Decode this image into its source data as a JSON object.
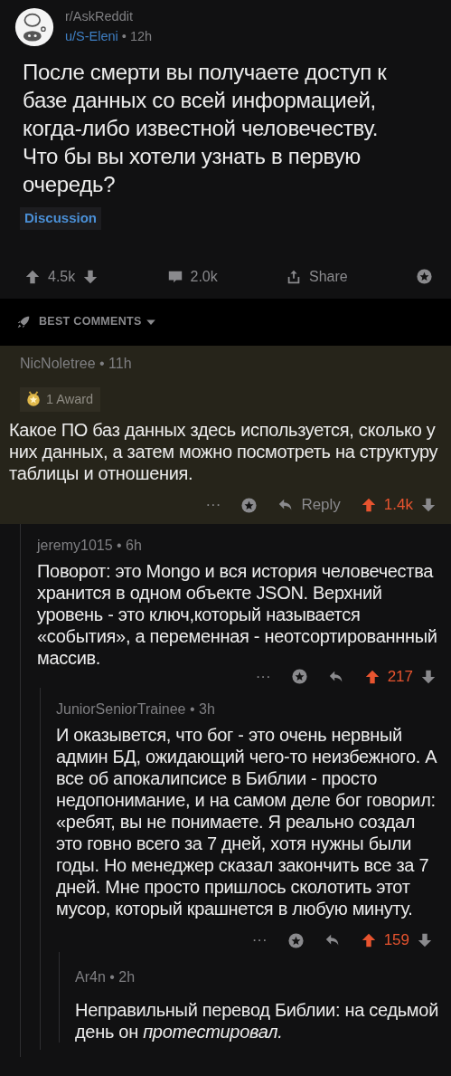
{
  "post": {
    "subreddit": "r/AskReddit",
    "author": "u/S-Eleni",
    "meta": "• 12h",
    "title": "После смерти вы получаете доступ к базе данных со всей информацией, когда-либо известной человечеству. Что бы вы хотели узнать в первую очередь?",
    "flair": "Discussion",
    "score": "4.5k",
    "upvoted": false,
    "comments": "2.0k",
    "share": "Share"
  },
  "sort": {
    "label": "BEST COMMENTS"
  },
  "comments": [
    {
      "meta": "NicNoletree • 11h",
      "highlighted": true,
      "award": "1 Award",
      "body": "Какое ПО баз данных здесь используется, сколько у них данных, а затем можно посмотреть на структуру таблицы и отношения.",
      "more": "···",
      "reply": "Reply",
      "score": "1.4k",
      "upvoted": true,
      "children": [
        {
          "meta": "jeremy1015 • 6h",
          "highlighted": false,
          "body": "Поворот: это Mongo и вся история человечества хранится в одном объекте JSON. Верхний уровень - это ключ,который называется «события», а переменная - неотсортированнный массив.",
          "more": "···",
          "score": "217",
          "upvoted": true,
          "children": [
            {
              "meta": "JuniorSeniorTrainee • 3h",
              "highlighted": false,
              "body": "И оказывется, что бог - это очень нервный админ БД, ожидающий чего-то неизбежного. А все об апокалипсисе в Библии - просто недопонимание, и на самом деле бог говорил: «ребят, вы не понимаете. Я реально создал это говно всего за 7 дней, хотя нужны были годы. Но менеджер сказал закончить все за 7 дней. Мне просто пришлось сколотить этот мусор, который крашнется в любую минуту.",
              "more": "···",
              "score": "159",
              "upvoted": true,
              "children": [
                {
                  "meta": "Ar4n • 2h",
                  "highlighted": false,
                  "body": "Неправильный перевод Библии: на седьмой день он *протестировал.*"
                }
              ]
            }
          ]
        }
      ]
    }
  ]
}
